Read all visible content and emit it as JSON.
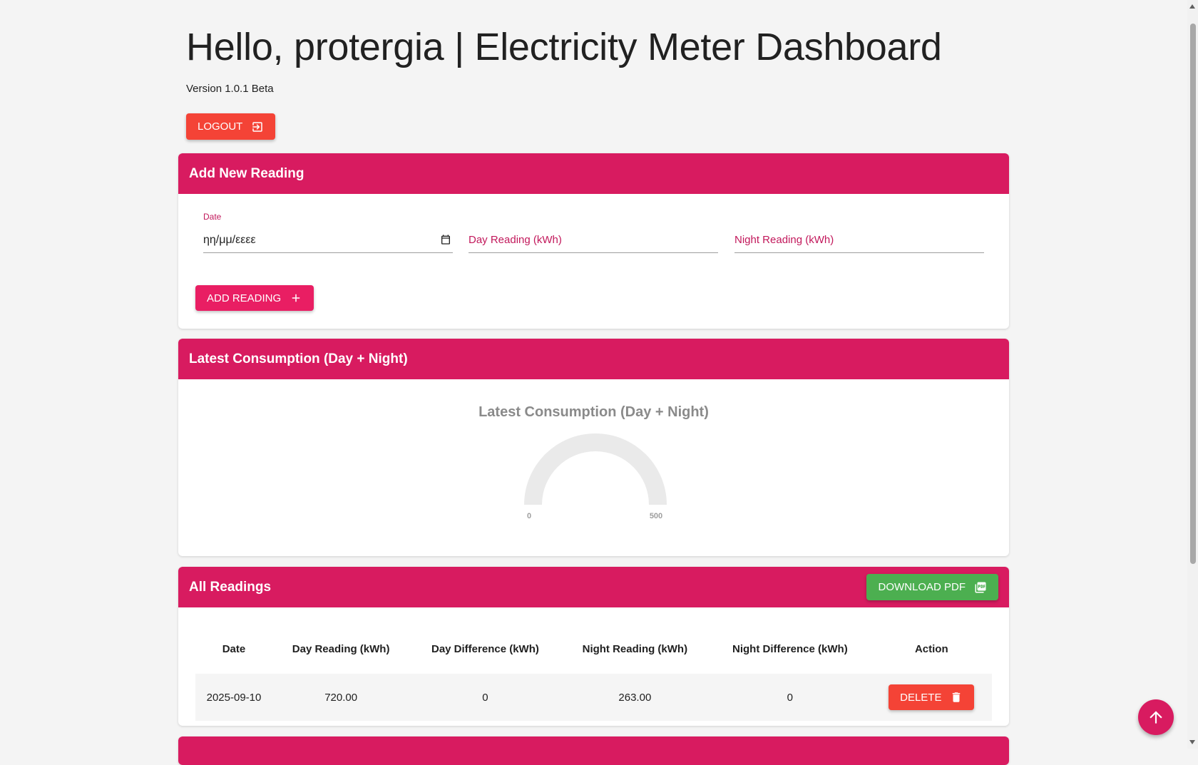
{
  "header": {
    "title": "Hello, protergia | Electricity Meter Dashboard",
    "version": "Version 1.0.1 Beta",
    "logout_label": "LOGOUT"
  },
  "add_reading": {
    "title": "Add New Reading",
    "date_label": "Date",
    "date_placeholder": "ηη/μμ/εεεε",
    "day_placeholder": "Day Reading (kWh)",
    "night_placeholder": "Night Reading (kWh)",
    "button_label": "ADD READING"
  },
  "consumption": {
    "title": "Latest Consumption (Day + Night)",
    "gauge_title": "Latest Consumption (Day + Night)",
    "gauge_min": "0",
    "gauge_max": "500"
  },
  "readings": {
    "title": "All Readings",
    "download_label": "DOWNLOAD PDF",
    "columns": [
      "Date",
      "Day Reading (kWh)",
      "Day Difference (kWh)",
      "Night Reading (kWh)",
      "Night Difference (kWh)",
      "Action"
    ],
    "rows": [
      {
        "date": "2025-09-10",
        "day_reading": "720.00",
        "day_diff": "0",
        "night_reading": "263.00",
        "night_diff": "0",
        "action": "DELETE"
      }
    ]
  },
  "colors": {
    "primary": "#d81b60",
    "danger": "#f44336",
    "success": "#4caf50",
    "accent": "#e91e63"
  }
}
